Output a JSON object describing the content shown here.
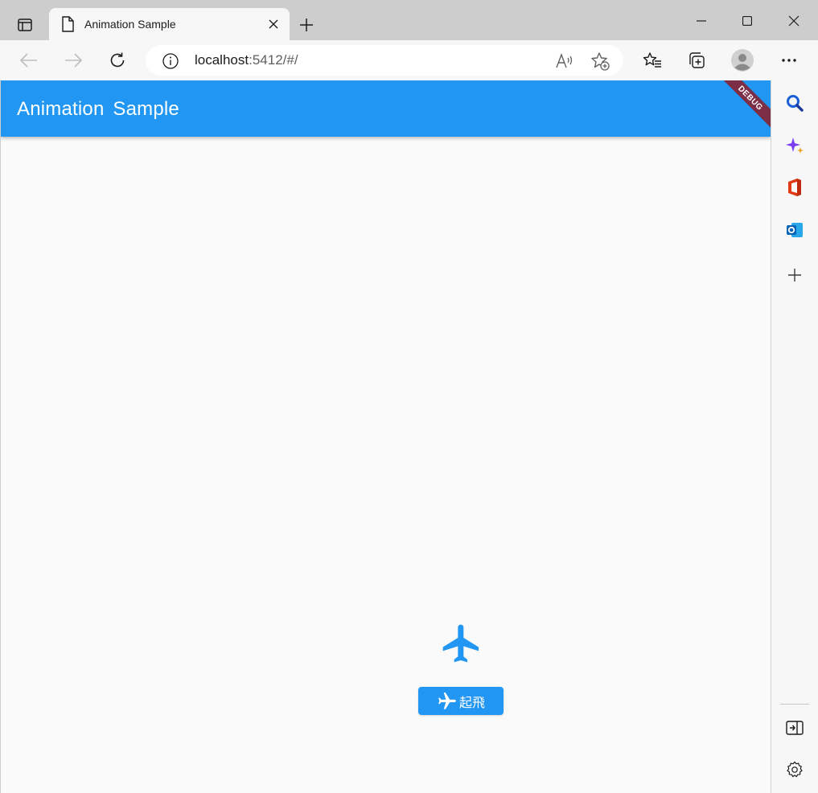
{
  "browser": {
    "tab": {
      "title": "Animation Sample"
    },
    "address": {
      "host": "localhost",
      "path": ":5412/#/"
    },
    "toolbar": {
      "back_icon": "arrow-left-icon",
      "forward_icon": "arrow-right-icon",
      "refresh_icon": "refresh-icon",
      "read_aloud_icon": "read-aloud-icon",
      "add_favorite_icon": "star-add-icon",
      "favorites_icon": "favorites-icon",
      "collections_icon": "collections-icon",
      "profile_icon": "profile-icon",
      "more_icon": "more-icon"
    },
    "sidebar": {
      "items": [
        "search-icon",
        "copilot-icon",
        "office-icon",
        "outlook-icon",
        "add-icon",
        "split-screen-icon",
        "settings-icon"
      ]
    }
  },
  "app": {
    "title": "Animation  Sample",
    "debug_banner": "DEBUG",
    "takeoff_button": {
      "label": "起飛"
    },
    "colors": {
      "primary": "#2196f3",
      "banner": "#7b2e46",
      "background": "#fafafa"
    }
  }
}
